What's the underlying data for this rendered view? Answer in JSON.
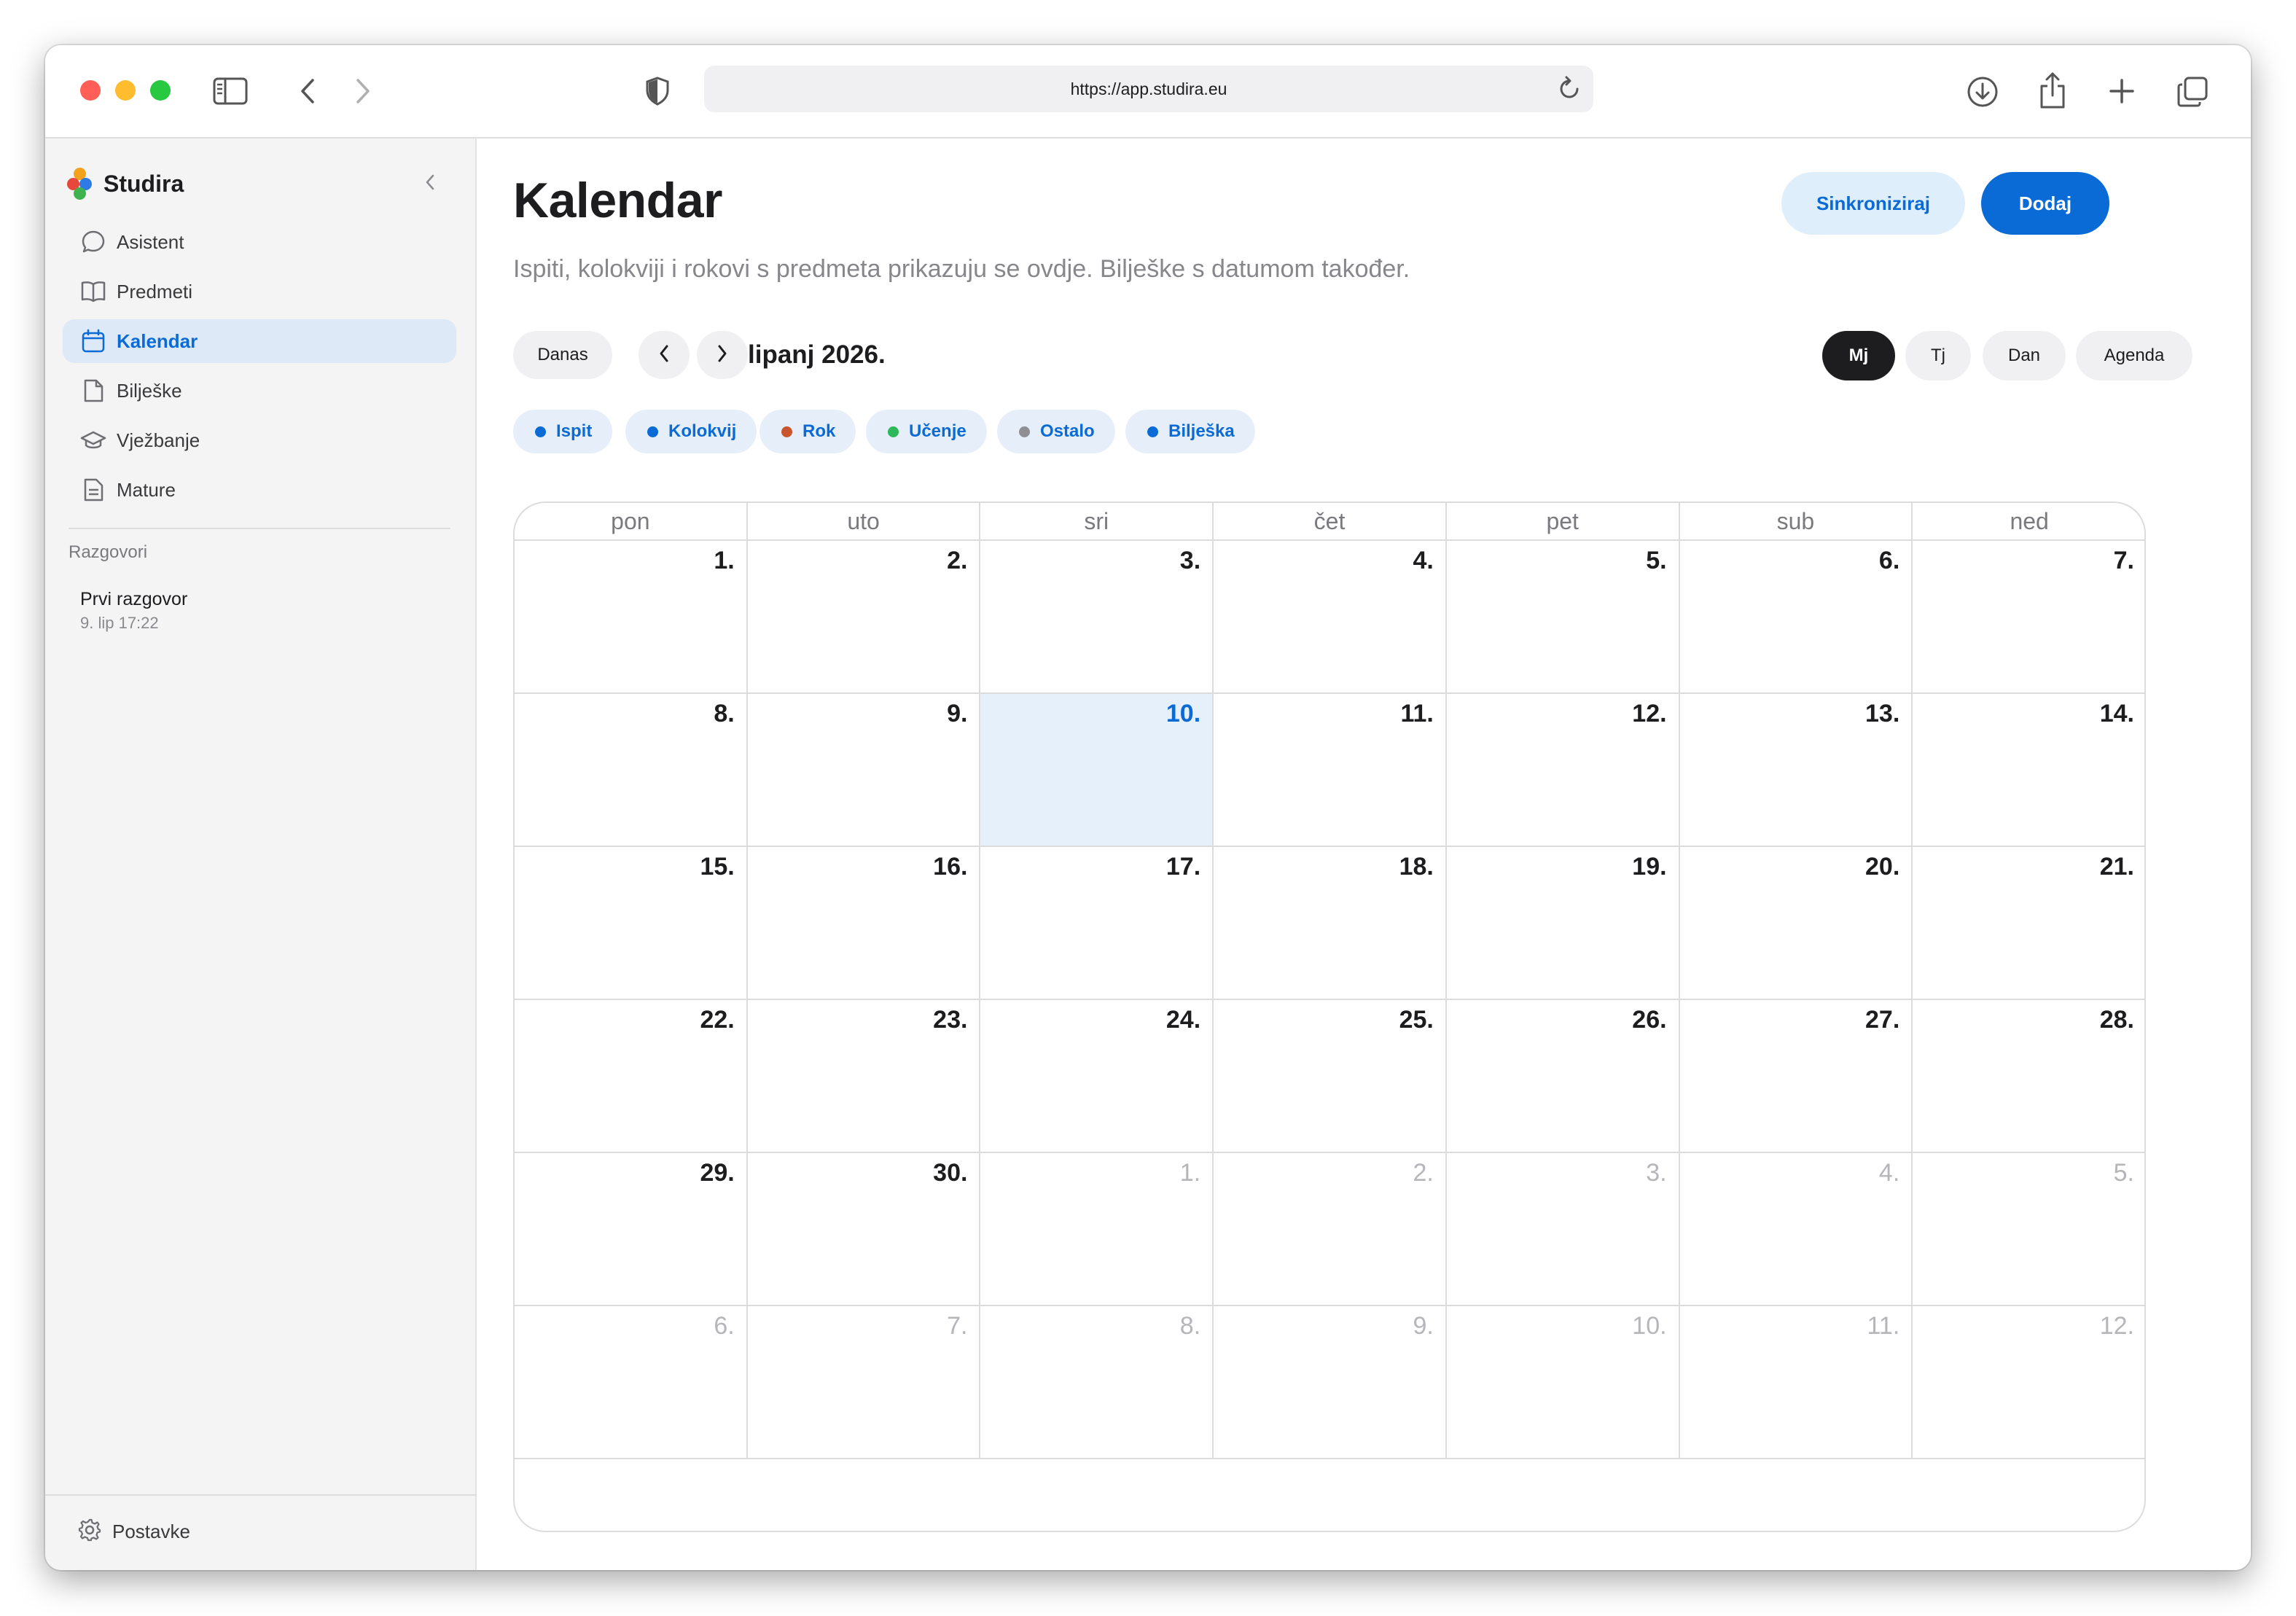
{
  "browser": {
    "url": "https://app.studira.eu"
  },
  "sidebar": {
    "brand": "Studira",
    "items": [
      {
        "label": "Asistent",
        "icon": "chat-bubble-icon",
        "active": false
      },
      {
        "label": "Predmeti",
        "icon": "book-icon",
        "active": false
      },
      {
        "label": "Kalendar",
        "icon": "calendar-icon",
        "active": true
      },
      {
        "label": "Bilješke",
        "icon": "note-icon",
        "active": false
      },
      {
        "label": "Vježbanje",
        "icon": "graduation-cap-icon",
        "active": false
      },
      {
        "label": "Mature",
        "icon": "document-icon",
        "active": false
      }
    ],
    "section_label": "Razgovori",
    "conversations": [
      {
        "title": "Prvi razgovor",
        "time": "9. lip 17:22"
      }
    ],
    "settings_label": "Postavke"
  },
  "header": {
    "title": "Kalendar",
    "subtitle": "Ispiti, kolokviji i rokovi s predmeta prikazuju se ovdje. Bilješke s datumom također.",
    "sync_label": "Sinkroniziraj",
    "add_label": "Dodaj"
  },
  "controls": {
    "today_label": "Danas",
    "month_label": "lipanj 2026.",
    "views": [
      {
        "label": "Mj",
        "active": true
      },
      {
        "label": "Tj",
        "active": false
      },
      {
        "label": "Dan",
        "active": false
      },
      {
        "label": "Agenda",
        "active": false
      }
    ]
  },
  "filters": [
    {
      "label": "Ispit",
      "color": "#0a6bd6"
    },
    {
      "label": "Kolokvij",
      "color": "#0a6bd6"
    },
    {
      "label": "Rok",
      "color": "#c8552b"
    },
    {
      "label": "Učenje",
      "color": "#2fb85a"
    },
    {
      "label": "Ostalo",
      "color": "#8e8e93"
    },
    {
      "label": "Bilješka",
      "color": "#0a6bd6"
    }
  ],
  "calendar": {
    "weekdays": [
      "pon",
      "uto",
      "sri",
      "čet",
      "pet",
      "sub",
      "ned"
    ],
    "days": [
      {
        "n": "1.",
        "other": false
      },
      {
        "n": "2.",
        "other": false
      },
      {
        "n": "3.",
        "other": false
      },
      {
        "n": "4.",
        "other": false
      },
      {
        "n": "5.",
        "other": false
      },
      {
        "n": "6.",
        "other": false
      },
      {
        "n": "7.",
        "other": false
      },
      {
        "n": "8.",
        "other": false
      },
      {
        "n": "9.",
        "other": false
      },
      {
        "n": "10.",
        "other": false,
        "today": true
      },
      {
        "n": "11.",
        "other": false
      },
      {
        "n": "12.",
        "other": false
      },
      {
        "n": "13.",
        "other": false
      },
      {
        "n": "14.",
        "other": false
      },
      {
        "n": "15.",
        "other": false
      },
      {
        "n": "16.",
        "other": false
      },
      {
        "n": "17.",
        "other": false
      },
      {
        "n": "18.",
        "other": false
      },
      {
        "n": "19.",
        "other": false
      },
      {
        "n": "20.",
        "other": false
      },
      {
        "n": "21.",
        "other": false
      },
      {
        "n": "22.",
        "other": false
      },
      {
        "n": "23.",
        "other": false
      },
      {
        "n": "24.",
        "other": false
      },
      {
        "n": "25.",
        "other": false
      },
      {
        "n": "26.",
        "other": false
      },
      {
        "n": "27.",
        "other": false
      },
      {
        "n": "28.",
        "other": false
      },
      {
        "n": "29.",
        "other": false
      },
      {
        "n": "30.",
        "other": false
      },
      {
        "n": "1.",
        "other": true
      },
      {
        "n": "2.",
        "other": true
      },
      {
        "n": "3.",
        "other": true
      },
      {
        "n": "4.",
        "other": true
      },
      {
        "n": "5.",
        "other": true
      },
      {
        "n": "6.",
        "other": true
      },
      {
        "n": "7.",
        "other": true
      },
      {
        "n": "8.",
        "other": true
      },
      {
        "n": "9.",
        "other": true
      },
      {
        "n": "10.",
        "other": true
      },
      {
        "n": "11.",
        "other": true
      },
      {
        "n": "12.",
        "other": true
      }
    ]
  }
}
